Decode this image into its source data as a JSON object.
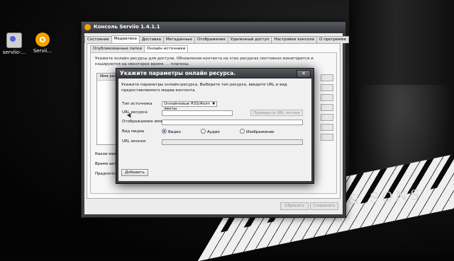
{
  "desktop": {
    "icons": [
      {
        "label": "serviio-...",
        "icon": "serviio-script-icon"
      },
      {
        "label": "Servii...",
        "icon": "serviio-app-icon"
      }
    ],
    "brand_text": "& SONS"
  },
  "main_window": {
    "title": "Консоль Serviio 1.4.1.1",
    "tabs": [
      "Состояние",
      "Медиатека",
      "Доставка",
      "Метаданные",
      "Отображение",
      "Удаленный доступ",
      "Настройки консоли",
      "О программе"
    ],
    "active_tab": "Медиатека",
    "subtabs": [
      "Опубликованные папки",
      "Онлайн источники"
    ],
    "active_subtab": "Онлайн источники",
    "description": "Укажите онлайн ресурсы для доступа. Обновления контента на этих ресурсах постоянно мониторится и кэшируются на некоторое время. ... плагины.",
    "grid_header": "Имя ресу",
    "labels": {
      "max": "Какое макси",
      "time": "Время актуа",
      "preferred": "Предпочтит"
    },
    "buttons": {
      "reset": "Сбросить",
      "save": "Сохранить"
    }
  },
  "dialog": {
    "title": "Укажите параметры онлайн ресурса.",
    "close_glyph": "✕",
    "description": "Укажите параметры онлайн-ресурса. Выберите тип ресурса, введите URL и вид предоставляемого медиа-контента.",
    "fields": {
      "source_type_label": "Тип источника",
      "source_type_value": "Онлайновые RSS/Atom ленты",
      "url_label": "URL ресурса",
      "url_value": "",
      "check_url_button": "Проверьте URL потока",
      "display_name_label": "Отображаемое имя",
      "display_name_value": "",
      "media_type_label": "Вид медиа",
      "media_options": [
        "Видео",
        "Аудио",
        "Изображение"
      ],
      "media_selected": "Видео",
      "icon_url_label": "URL иконки",
      "icon_url_value": ""
    },
    "add_button": "Добавить"
  }
}
